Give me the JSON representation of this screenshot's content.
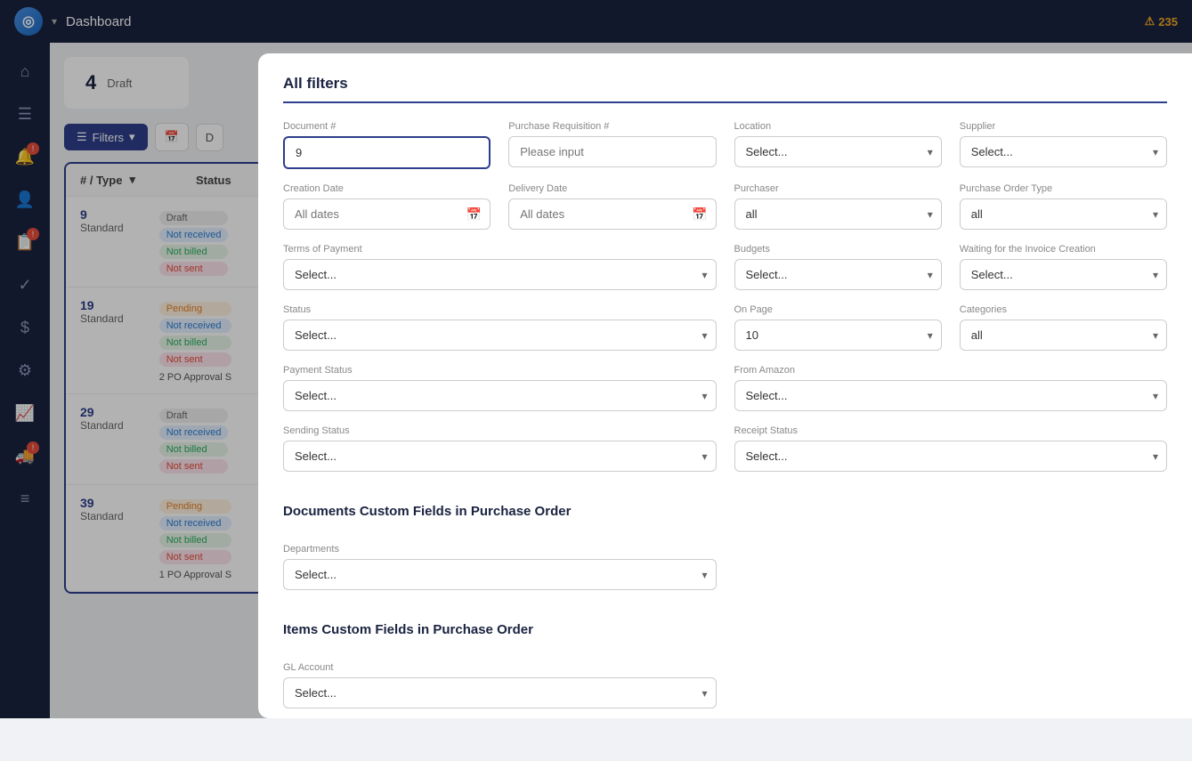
{
  "topbar": {
    "title": "Dashboard",
    "alert_count": "235"
  },
  "sidebar": {
    "items": [
      {
        "name": "home",
        "icon": "⌂",
        "badge": null,
        "active": false
      },
      {
        "name": "orders",
        "icon": "☰",
        "badge": null,
        "active": false
      },
      {
        "name": "alerts",
        "icon": "🔔",
        "badge": "!",
        "active": false
      },
      {
        "name": "users",
        "icon": "👤",
        "badge": null,
        "active": false
      },
      {
        "name": "reports",
        "icon": "📋",
        "badge": "!",
        "active": false
      },
      {
        "name": "check",
        "icon": "✓",
        "badge": null,
        "active": false
      },
      {
        "name": "dollar",
        "icon": "$",
        "badge": null,
        "active": false
      },
      {
        "name": "settings",
        "icon": "⚙",
        "badge": null,
        "active": false
      },
      {
        "name": "chart",
        "icon": "📈",
        "badge": null,
        "active": false
      },
      {
        "name": "truck",
        "icon": "🚚",
        "badge": "!",
        "active": false
      },
      {
        "name": "menu",
        "icon": "≡",
        "badge": null,
        "active": false
      }
    ]
  },
  "stats": [
    {
      "number": "4",
      "label": "Draft"
    }
  ],
  "toolbar": {
    "filters_label": "Filters",
    "filter_chevron": "▾"
  },
  "list": {
    "header": {
      "type_label": "# / Type",
      "status_label": "Status"
    },
    "items": [
      {
        "number": "9",
        "type": "Standard",
        "statuses": [
          "Draft",
          "Not received",
          "Not billed",
          "Not sent"
        ],
        "po_approval": null
      },
      {
        "number": "19",
        "type": "Standard",
        "statuses": [
          "Pending",
          "Not received",
          "Not billed",
          "Not sent"
        ],
        "po_approval": "2 PO Approval S"
      },
      {
        "number": "29",
        "type": "Standard",
        "statuses": [
          "Draft",
          "Not received",
          "Not billed",
          "Not sent"
        ],
        "po_approval": null
      },
      {
        "number": "39",
        "type": "Standard",
        "statuses": [
          "Pending",
          "Not received",
          "Not billed",
          "Not sent"
        ],
        "po_approval": "1 PO Approval S"
      }
    ]
  },
  "modal": {
    "title": "All filters",
    "fields": {
      "document_number": {
        "label": "Document #",
        "value": "9",
        "placeholder": ""
      },
      "purchase_requisition": {
        "label": "Purchase Requisition #",
        "placeholder": "Please input"
      },
      "location": {
        "label": "Location",
        "placeholder": "Select..."
      },
      "supplier": {
        "label": "Supplier",
        "placeholder": "Select..."
      },
      "creation_date": {
        "label": "Creation Date",
        "placeholder": "All dates"
      },
      "delivery_date": {
        "label": "Delivery Date",
        "placeholder": "All dates"
      },
      "purchaser": {
        "label": "Purchaser",
        "placeholder": "all"
      },
      "purchase_order_type": {
        "label": "Purchase Order Type",
        "placeholder": "all"
      },
      "terms_of_payment": {
        "label": "Terms of Payment",
        "placeholder": "Select..."
      },
      "budgets": {
        "label": "Budgets",
        "placeholder": "Select..."
      },
      "waiting_invoice": {
        "label": "Waiting for the Invoice Creation",
        "placeholder": "Select..."
      },
      "status": {
        "label": "Status",
        "placeholder": "Select..."
      },
      "on_page": {
        "label": "On Page",
        "value": "10",
        "placeholder": "10"
      },
      "categories": {
        "label": "Categories",
        "placeholder": "all"
      },
      "payment_status": {
        "label": "Payment Status",
        "placeholder": "Select..."
      },
      "from_amazon": {
        "label": "From Amazon",
        "placeholder": "Select..."
      },
      "sending_status": {
        "label": "Sending Status",
        "placeholder": "Select..."
      },
      "receipt_status": {
        "label": "Receipt Status",
        "placeholder": "Select..."
      },
      "departments": {
        "label": "Departments",
        "placeholder": "Select..."
      },
      "gl_account": {
        "label": "GL Account",
        "placeholder": "Select..."
      }
    },
    "sections": {
      "documents_custom": "Documents Custom Fields in Purchase Order",
      "items_custom": "Items Custom Fields in Purchase Order"
    }
  }
}
